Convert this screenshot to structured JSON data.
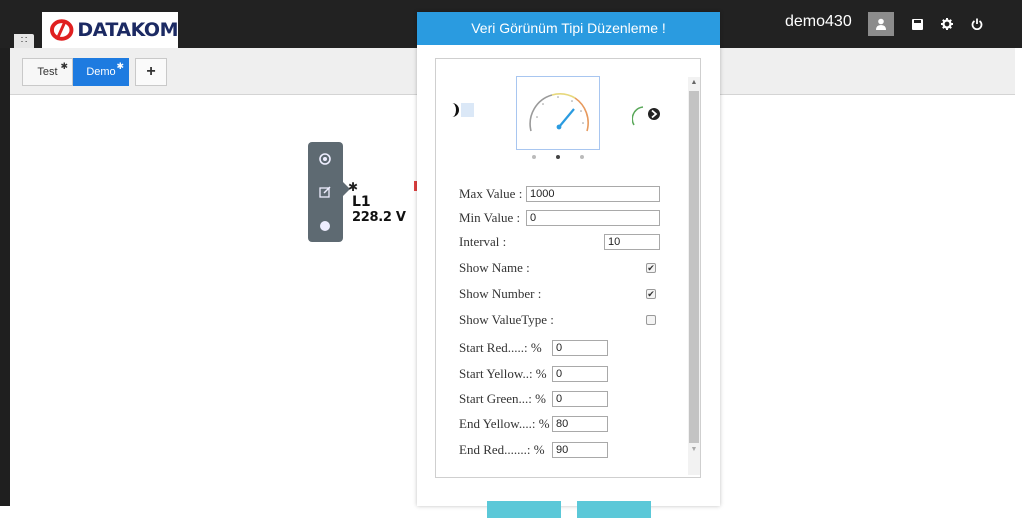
{
  "topbar": {
    "grid_icon": "apps-grid-icon",
    "logo_text": "DATAKOM",
    "logo_icon": "datakom-logo-icon",
    "username": "demo430",
    "buttons": [
      {
        "name": "user-icon"
      },
      {
        "name": "save-icon"
      },
      {
        "name": "gear-icon"
      },
      {
        "name": "power-icon"
      }
    ]
  },
  "tabs": [
    {
      "label": "Test",
      "active": false
    },
    {
      "label": "Demo",
      "active": true
    },
    {
      "label": "+"
    }
  ],
  "widget": {
    "name": "L1",
    "value": "228.2 V",
    "tool_icons": [
      "gauge-icon",
      "edit-icon",
      "circle-icon"
    ]
  },
  "modal": {
    "title": "Veri Görünüm Tipi Düzenleme !",
    "carousel": {
      "dots": 3,
      "active_dot": 2
    },
    "fields": [
      {
        "label": "Max Value :",
        "value": "1000"
      },
      {
        "label": "Min Value :",
        "value": "0"
      },
      {
        "label": "Interval :",
        "value": "10"
      }
    ],
    "checkboxes": [
      {
        "label": "Show Name :",
        "checked": true,
        "mark": "✔"
      },
      {
        "label": "Show Number :",
        "checked": true,
        "mark": "✔"
      },
      {
        "label": "Show ValueType :",
        "checked": false,
        "mark": ""
      }
    ],
    "percent_fields": [
      {
        "label": "Start Red.....: %",
        "value": "0"
      },
      {
        "label": "Start Yellow..: %",
        "value": "0"
      },
      {
        "label": "Start Green...: %",
        "value": "0"
      },
      {
        "label": "End Yellow....: %",
        "value": "80"
      },
      {
        "label": "End Red.......: %",
        "value": "90"
      }
    ]
  },
  "colors": {
    "header_blue": "#2a9be0",
    "tab_active": "#1e7be0",
    "topbar": "#222222",
    "footer_button": "#5bc8d8"
  }
}
